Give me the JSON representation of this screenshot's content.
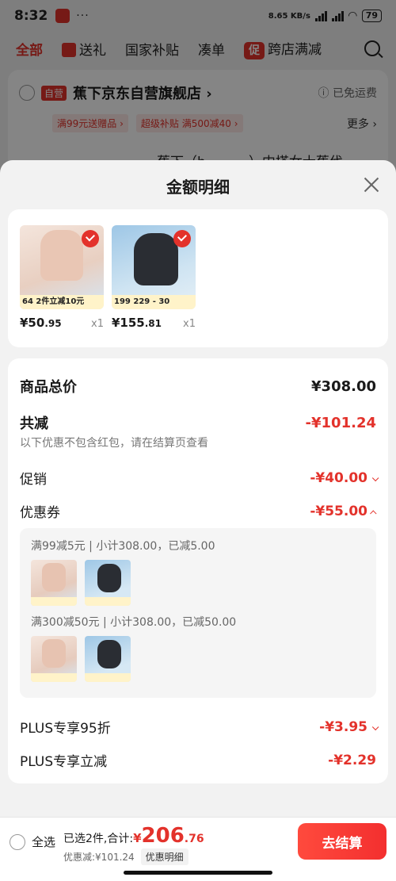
{
  "status_bar": {
    "time": "8:32",
    "dots": "···",
    "net_speed": "8.65 KB/s",
    "battery": "79"
  },
  "top_tabs": [
    "全部",
    "送礼",
    "国家补贴",
    "凑单",
    "跨店满减"
  ],
  "promo_icon_text": "促",
  "shop": {
    "tag": "自营",
    "name": "蕉下京东自营旗舰店 ›",
    "free_shipping": "ⓘ 已免运费",
    "coupons": [
      "满99元送赠品 ›",
      "超级补贴 满500减40 ›"
    ],
    "more": "更多 ›",
    "product_title_peek": "蕉下（b..........）内搭女士蕉伐"
  },
  "sheet": {
    "title": "金额明细",
    "products": [
      {
        "price_int": "¥50",
        "price_dec": ".95",
        "qty": "x1",
        "strip": "64  2件立减10元"
      },
      {
        "price_int": "¥155",
        "price_dec": ".81",
        "qty": "x1",
        "strip": "199  229 - 30"
      }
    ],
    "total_label": "商品总价",
    "total_value": "¥308.00",
    "discount_label": "共减",
    "discount_value": "-¥101.24",
    "note": "以下优惠不包含红包，请在结算页查看",
    "promo_label": "促销",
    "promo_value": "-¥40.00",
    "coupon_label": "优惠券",
    "coupon_value": "-¥55.00",
    "coupon_lines": [
      "满99减5元 | 小计308.00，已减5.00",
      "满300减50元 | 小计308.00，已减50.00"
    ],
    "plus95_label": "PLUS专享95折",
    "plus95_value": "-¥3.95",
    "plus_label": "PLUS专享立减",
    "plus_value": "-¥2.29"
  },
  "bottom": {
    "select_all": "全选",
    "selected_text": "已选2件,合计:",
    "yen": "¥",
    "total_int": "206",
    "total_dec": ".76",
    "discount_text": "优惠减:¥101.24",
    "detail_tag": "优惠明细",
    "checkout": "去结算"
  },
  "colors": {
    "accent_red": "#e3322b",
    "checkout_gradient_start": "#ff4a3d",
    "checkout_gradient_end": "#f32f2f"
  }
}
